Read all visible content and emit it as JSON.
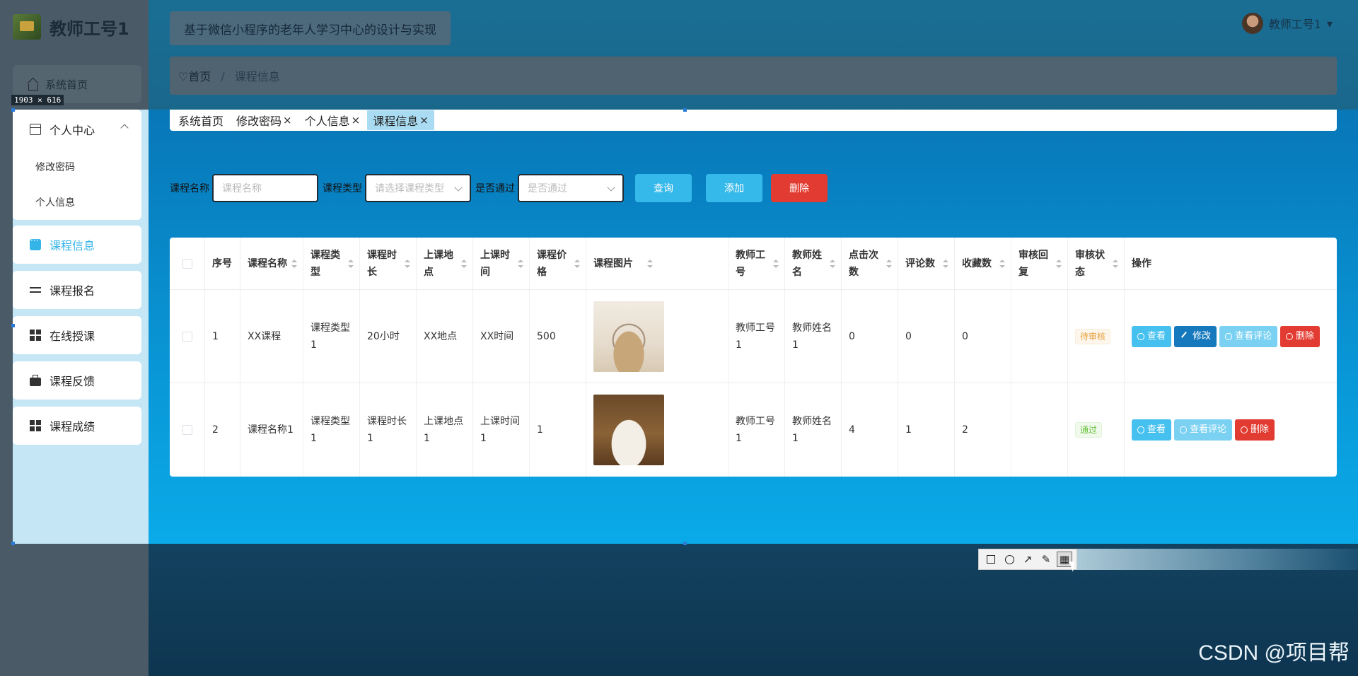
{
  "app": {
    "brand_title": "教师工号1",
    "top_title": "基于微信小程序的老年人学习中心的设计与实现",
    "user_name": "教师工号1",
    "user_caret": "▾",
    "dim_home_label": "系统首页",
    "selection_size": "1903 × 616"
  },
  "breadcrumb": {
    "home": "首页",
    "separator": "/",
    "current": "课程信息"
  },
  "sidebar": {
    "group": {
      "label": "个人中心",
      "children": [
        "修改密码",
        "个人信息"
      ]
    },
    "items": [
      "课程信息",
      "课程报名",
      "在线授课",
      "课程反馈",
      "课程成绩"
    ],
    "active": "课程信息"
  },
  "tags": {
    "items": [
      {
        "label": "系统首页",
        "closable": false
      },
      {
        "label": "修改密码",
        "closable": true
      },
      {
        "label": "个人信息",
        "closable": true
      },
      {
        "label": "课程信息",
        "closable": true,
        "active": true
      }
    ],
    "close_glyph": "×"
  },
  "filters": {
    "name_label": "课程名称",
    "name_placeholder": "课程名称",
    "type_label": "课程类型",
    "type_placeholder": "请选择课程类型",
    "pass_label": "是否通过",
    "pass_placeholder": "是否通过",
    "query_button": "查询",
    "add_button": "添加",
    "delete_button": "删除"
  },
  "table": {
    "columns": [
      {
        "key": "chk",
        "label": ""
      },
      {
        "key": "no",
        "label": "序号"
      },
      {
        "key": "name",
        "label": "课程名称"
      },
      {
        "key": "type",
        "label": "课程类型"
      },
      {
        "key": "duration",
        "label": "课程时长"
      },
      {
        "key": "place",
        "label": "上课地点"
      },
      {
        "key": "time",
        "label": "上课时间"
      },
      {
        "key": "price",
        "label": "课程价格"
      },
      {
        "key": "image",
        "label": "课程图片"
      },
      {
        "key": "teacher_id",
        "label": "教师工号"
      },
      {
        "key": "teacher_name",
        "label": "教师姓名"
      },
      {
        "key": "clicks",
        "label": "点击次数"
      },
      {
        "key": "comments",
        "label": "评论数"
      },
      {
        "key": "favorites",
        "label": "收藏数"
      },
      {
        "key": "reply",
        "label": "审核回复"
      },
      {
        "key": "status",
        "label": "审核状态"
      },
      {
        "key": "ops",
        "label": "操作"
      }
    ],
    "rows": [
      {
        "no": "1",
        "name": "XX课程",
        "type": "课程类型1",
        "duration": "20小时",
        "place": "XX地点",
        "time": "XX时间",
        "price": "500",
        "teacher_id": "教师工号1",
        "teacher_name": "教师姓名1",
        "clicks": "0",
        "comments": "0",
        "favorites": "0",
        "reply": "",
        "status": "待审核",
        "actions": [
          "查看",
          "修改",
          "查看评论",
          "删除"
        ]
      },
      {
        "no": "2",
        "name": "课程名称1",
        "type": "课程类型1",
        "duration": "课程时长1",
        "place": "上课地点1",
        "time": "上课时间1",
        "price": "1",
        "teacher_id": "教师工号1",
        "teacher_name": "教师姓名1",
        "clicks": "4",
        "comments": "1",
        "favorites": "2",
        "reply": "",
        "status": "通过",
        "actions": [
          "查看",
          "查看评论",
          "删除"
        ]
      }
    ]
  },
  "drawing_toolbar": {
    "tools": [
      "rectangle",
      "ellipse",
      "arrow",
      "pencil",
      "mosaic"
    ],
    "active": "mosaic"
  },
  "watermark": "CSDN @项目帮",
  "colors": {
    "primary": "#35b8ea",
    "danger": "#e23b31",
    "edit": "#1779bd",
    "pending": "#e6a23c",
    "passed": "#67c23a"
  }
}
